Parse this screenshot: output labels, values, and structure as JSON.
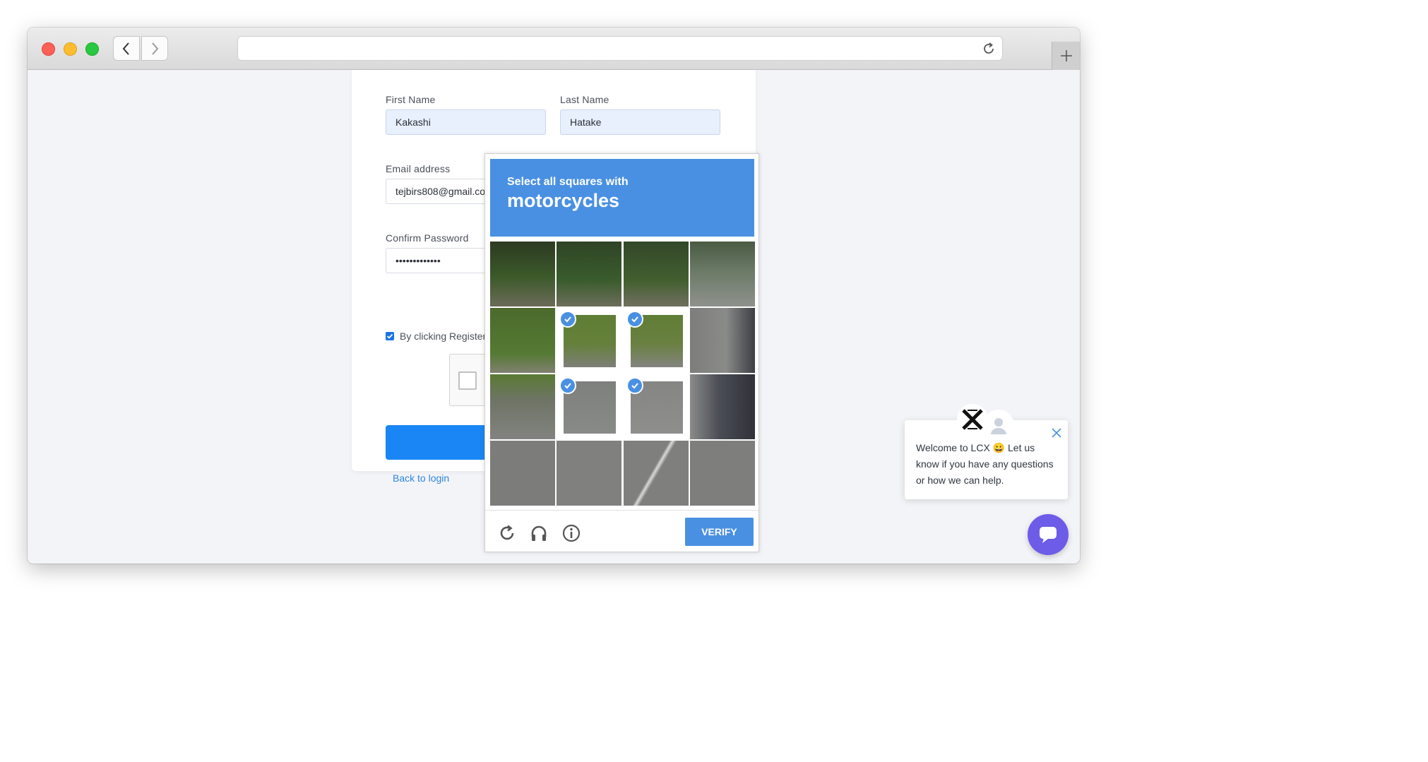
{
  "browser": {
    "address_value": "",
    "icons": {
      "back": "chevron-left-icon",
      "forward": "chevron-right-icon",
      "reload": "reload-icon",
      "new_tab": "plus-icon"
    }
  },
  "form": {
    "first_name": {
      "label": "First Name",
      "value": "Kakashi"
    },
    "last_name": {
      "label": "Last Name",
      "value": "Hatake"
    },
    "email": {
      "label": "Email address",
      "value": "tejbirs808@gmail.co"
    },
    "confirm_password": {
      "label": "Confirm Password",
      "value": "•••••••••••••"
    },
    "terms": {
      "text": "By clicking Register,",
      "checked": true
    },
    "back_to_login": "Back to login",
    "accent_color": "#1a86f5"
  },
  "captcha": {
    "instruction": "Select all squares with",
    "target": "motorcycles",
    "verify_label": "VERIFY",
    "header_color": "#4a90e2",
    "selected_tiles": [
      5,
      6,
      9,
      10
    ],
    "footer_icons": [
      "reload-icon",
      "headphones-icon",
      "info-icon"
    ]
  },
  "chat": {
    "message": "Welcome to LCX 😀 Let us know if you have any questions or how we can help.",
    "bubble_color": "#6c5ce7",
    "icons": {
      "logo": "lcx-logo-icon",
      "agent": "user-avatar-icon",
      "close": "close-icon",
      "launcher": "chat-icon"
    }
  }
}
